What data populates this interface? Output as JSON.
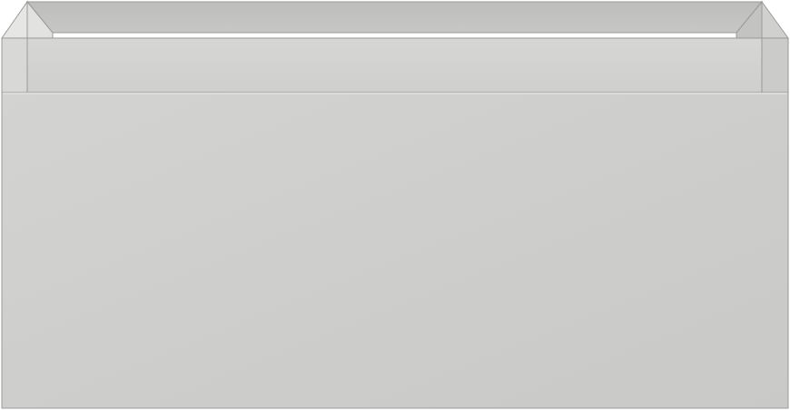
{
  "product": {
    "type": "vanity drawer unit",
    "finish_color": "#cfcfcd",
    "shadow_color": "#b9b9b7",
    "highlight_color": "#e2e2e0",
    "outline_color": "#9a9a98"
  }
}
